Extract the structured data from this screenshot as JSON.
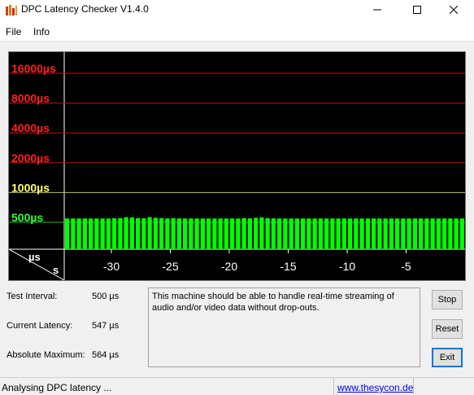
{
  "window": {
    "title": "DPC Latency Checker V1.4.0",
    "min_icon": "minimize-icon",
    "max_icon": "maximize-icon",
    "close_icon": "close-icon"
  },
  "menu": {
    "file": "File",
    "info": "Info"
  },
  "chart_data": {
    "type": "bar",
    "y_scale": "log",
    "y_tick_labels": [
      "16000µs",
      "8000µs",
      "4000µs",
      "2000µs",
      "1000µs",
      "500µs"
    ],
    "y_tick_values": [
      16000,
      8000,
      4000,
      2000,
      1000,
      500
    ],
    "y_label_colors": [
      "#ff2020",
      "#ff2020",
      "#ff2020",
      "#ff2020",
      "#ffff66",
      "#33ff33"
    ],
    "gridline_colors": [
      "#c01010",
      "#c01010",
      "#c01010",
      "#c01010",
      "#c0c060",
      "#20c020"
    ],
    "x_unit_label": "s",
    "y_unit_label": "µs",
    "x_tick_labels": [
      "-30",
      "-25",
      "-20",
      "-15",
      "-10",
      "-5"
    ],
    "x_tick_values": [
      -30,
      -25,
      -20,
      -15,
      -10,
      -5
    ],
    "x_range": [
      -34,
      0
    ],
    "bar_color": "#00ff00",
    "values": [
      547,
      547,
      547,
      547,
      547,
      547,
      547,
      547,
      550,
      552,
      564,
      560,
      552,
      550,
      564,
      556,
      552,
      548,
      552,
      548,
      547,
      547,
      547,
      547,
      547,
      547,
      547,
      547,
      547,
      547,
      552,
      548,
      556,
      560,
      552,
      548,
      547,
      547,
      547,
      547,
      547,
      547,
      547,
      547,
      547,
      547,
      547,
      547,
      547,
      547,
      547,
      547,
      547,
      547,
      547,
      547,
      547,
      547,
      547,
      547,
      547,
      547,
      547,
      547,
      547,
      547,
      547,
      547
    ]
  },
  "info": {
    "test_interval_label": "Test Interval:",
    "test_interval_value": "500 µs",
    "current_latency_label": "Current Latency:",
    "current_latency_value": "547 µs",
    "absolute_max_label": "Absolute Maximum:",
    "absolute_max_value": "564 µs"
  },
  "message": "This machine should be able to handle real-time streaming of audio and/or video data without drop-outs.",
  "buttons": {
    "stop": "Stop",
    "reset": "Reset",
    "exit": "Exit"
  },
  "status": {
    "text": "Analysing DPC latency ...",
    "link": "www.thesycon.de"
  }
}
